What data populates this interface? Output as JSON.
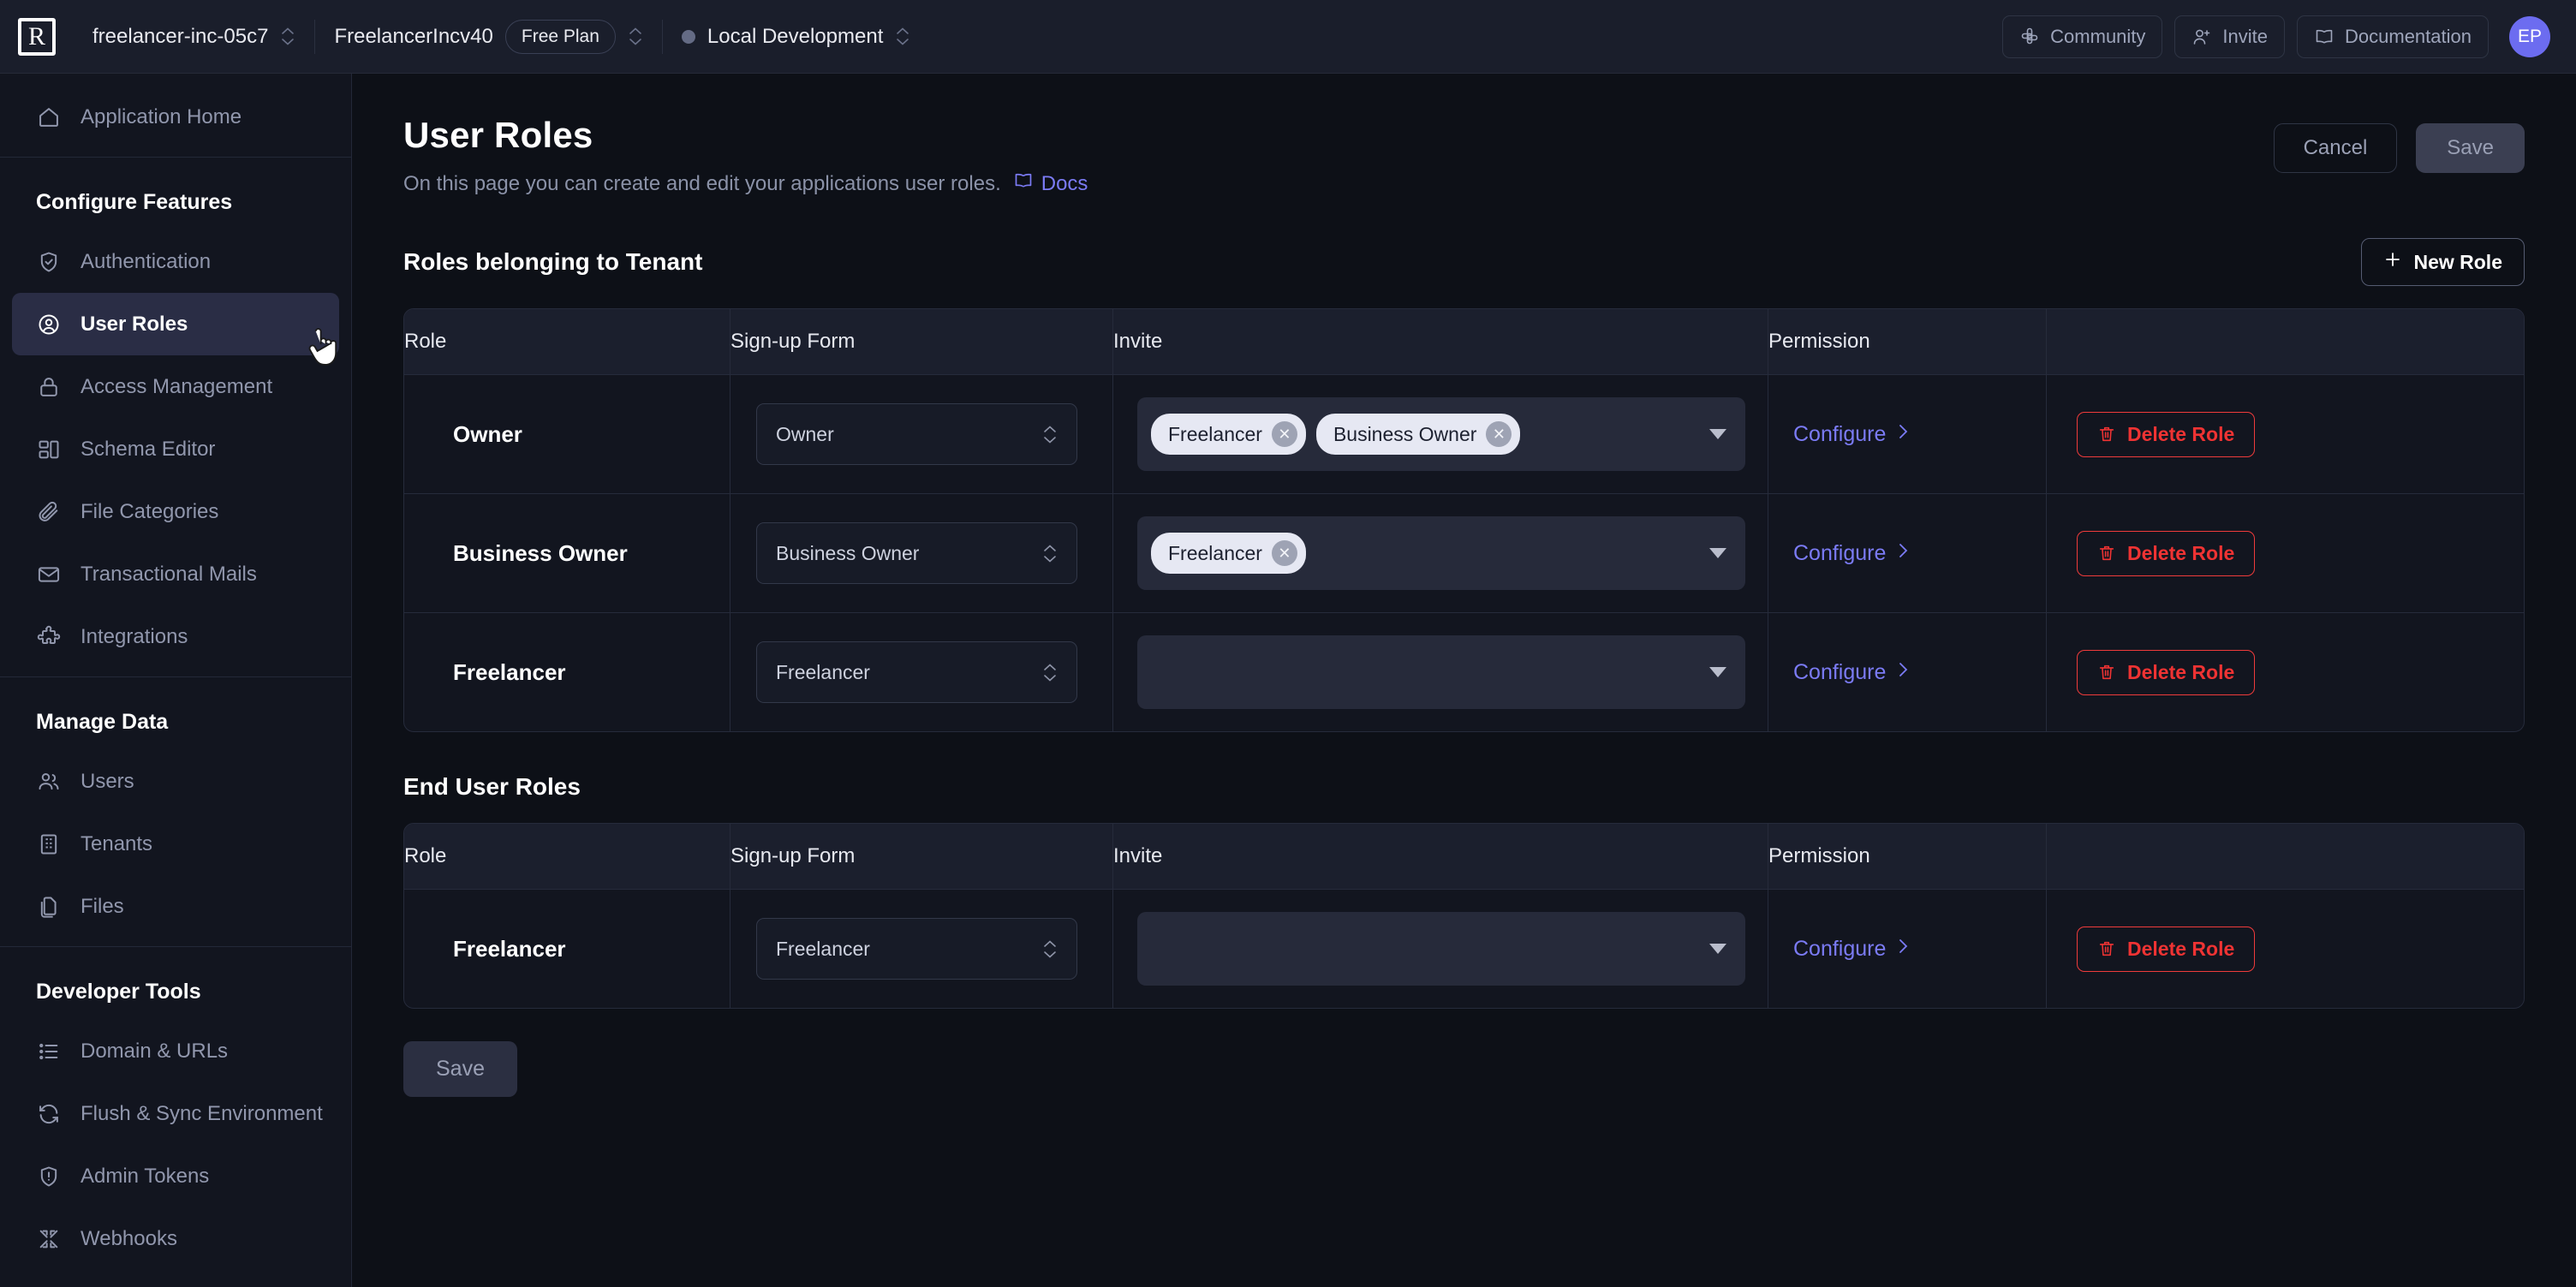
{
  "topbar": {
    "logo_letter": "R",
    "org_name": "freelancer-inc-05c7",
    "app_name": "FreelancerIncv40",
    "plan": "Free Plan",
    "environment": "Local Development",
    "community_label": "Community",
    "invite_label": "Invite",
    "documentation_label": "Documentation",
    "avatar_initials": "EP"
  },
  "sidebar": {
    "home_label": "Application Home",
    "group_configure": "Configure Features",
    "group_manage": "Manage Data",
    "group_dev": "Developer Tools",
    "configure_items": [
      {
        "label": "Authentication",
        "icon": "shield-check-icon",
        "active": false
      },
      {
        "label": "User Roles",
        "icon": "user-circle-icon",
        "active": true
      },
      {
        "label": "Access Management",
        "icon": "lock-icon",
        "active": false
      },
      {
        "label": "Schema Editor",
        "icon": "schema-icon",
        "active": false
      },
      {
        "label": "File Categories",
        "icon": "paperclip-icon",
        "active": false
      },
      {
        "label": "Transactional Mails",
        "icon": "mail-icon",
        "active": false
      },
      {
        "label": "Integrations",
        "icon": "puzzle-icon",
        "active": false
      }
    ],
    "manage_items": [
      {
        "label": "Users",
        "icon": "users-icon"
      },
      {
        "label": "Tenants",
        "icon": "building-icon"
      },
      {
        "label": "Files",
        "icon": "files-icon"
      }
    ],
    "dev_items": [
      {
        "label": "Domain & URLs",
        "icon": "list-icon"
      },
      {
        "label": "Flush & Sync Environment",
        "icon": "refresh-icon"
      },
      {
        "label": "Admin Tokens",
        "icon": "shield-alert-icon"
      },
      {
        "label": "Webhooks",
        "icon": "webhook-icon"
      }
    ]
  },
  "page": {
    "title": "User Roles",
    "subtitle": "On this page you can create and edit your applications user roles.",
    "docs_label": "Docs",
    "cancel_label": "Cancel",
    "save_label": "Save",
    "save_bottom_label": "Save"
  },
  "tenant_section": {
    "title": "Roles belonging to Tenant",
    "new_role_label": "New Role",
    "columns": [
      "Role",
      "Sign-up Form",
      "Invite",
      "Permission",
      ""
    ],
    "rows": [
      {
        "role": "Owner",
        "signup_form": "Owner",
        "invite_chips": [
          "Freelancer",
          "Business Owner"
        ],
        "permission_label": "Configure",
        "delete_label": "Delete Role"
      },
      {
        "role": "Business Owner",
        "signup_form": "Business Owner",
        "invite_chips": [
          "Freelancer"
        ],
        "permission_label": "Configure",
        "delete_label": "Delete Role"
      },
      {
        "role": "Freelancer",
        "signup_form": "Freelancer",
        "invite_chips": [],
        "permission_label": "Configure",
        "delete_label": "Delete Role"
      }
    ]
  },
  "enduser_section": {
    "title": "End User Roles",
    "columns": [
      "Role",
      "Sign-up Form",
      "Invite",
      "Permission",
      ""
    ],
    "rows": [
      {
        "role": "Freelancer",
        "signup_form": "Freelancer",
        "invite_chips": [],
        "permission_label": "Configure",
        "delete_label": "Delete Role"
      }
    ]
  },
  "colors": {
    "accent": "#7b7bf5",
    "danger": "#ef3333",
    "sidebar_active": "#2a2d45",
    "avatar": "#6c6cf0"
  }
}
